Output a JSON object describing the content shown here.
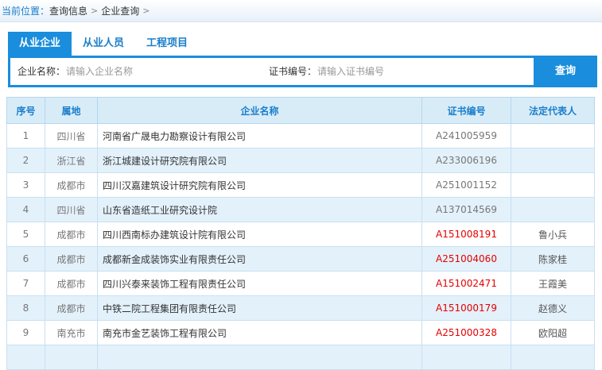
{
  "breadcrumb": {
    "lead": "当前位置：",
    "items": [
      "查询信息",
      "企业查询"
    ]
  },
  "tabs": [
    {
      "label": "从业企业",
      "active": true
    },
    {
      "label": "从业人员",
      "active": false
    },
    {
      "label": "工程项目",
      "active": false
    }
  ],
  "search": {
    "company_label": "企业名称：",
    "company_placeholder": "请输入企业名称",
    "cert_label": "证书编号：",
    "cert_placeholder": "请输入证书编号",
    "button": "查询"
  },
  "table": {
    "headers": [
      "序号",
      "属地",
      "企业名称",
      "证书编号",
      "法定代表人"
    ],
    "rows": [
      {
        "no": "1",
        "region": "四川省",
        "name": "河南省广晟电力勘察设计有限公司",
        "cert": "A241005959",
        "cert_red": false,
        "rep": ""
      },
      {
        "no": "2",
        "region": "浙江省",
        "name": "浙江城建设计研究院有限公司",
        "cert": "A233006196",
        "cert_red": false,
        "rep": ""
      },
      {
        "no": "3",
        "region": "成都市",
        "name": "四川汉嘉建筑设计研究院有限公司",
        "cert": "A251001152",
        "cert_red": false,
        "rep": ""
      },
      {
        "no": "4",
        "region": "四川省",
        "name": "山东省造纸工业研究设计院",
        "cert": "A137014569",
        "cert_red": false,
        "rep": ""
      },
      {
        "no": "5",
        "region": "成都市",
        "name": "四川西南标办建筑设计院有限公司",
        "cert": "A151008191",
        "cert_red": true,
        "rep": "鲁小兵"
      },
      {
        "no": "6",
        "region": "成都市",
        "name": "成都新金成装饰实业有限责任公司",
        "cert": "A251004060",
        "cert_red": true,
        "rep": "陈家桂"
      },
      {
        "no": "7",
        "region": "成都市",
        "name": "四川兴泰来装饰工程有限责任公司",
        "cert": "A151002471",
        "cert_red": true,
        "rep": "王霞美"
      },
      {
        "no": "8",
        "region": "成都市",
        "name": "中铁二院工程集团有限责任公司",
        "cert": "A151000179",
        "cert_red": true,
        "rep": "赵德义"
      },
      {
        "no": "9",
        "region": "南充市",
        "name": "南充市金艺装饰工程有限公司",
        "cert": "A251000328",
        "cert_red": true,
        "rep": "欧阳超"
      },
      {
        "no": "",
        "region": "",
        "name": "",
        "cert": "",
        "cert_red": false,
        "rep": ""
      }
    ]
  },
  "colors": {
    "accent": "#1a8ddc",
    "link": "#1a7ecb",
    "alt_row": "#e3f1fb",
    "header_bg": "#d8ecf8",
    "cert_highlight": "#e50000"
  }
}
